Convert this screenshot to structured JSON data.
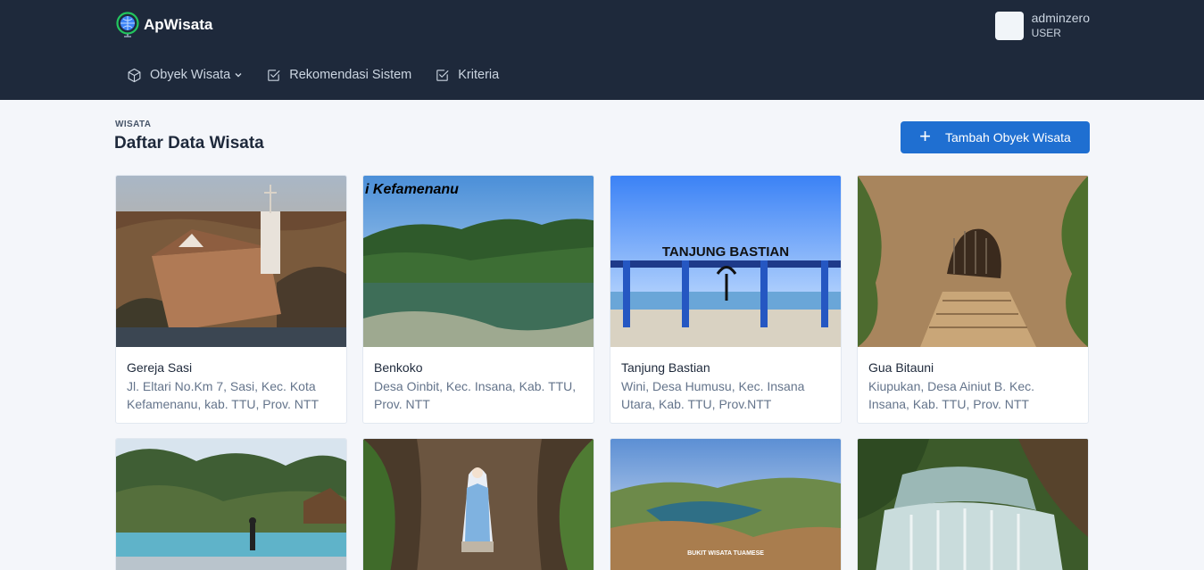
{
  "app": {
    "name": "ApWisata"
  },
  "user": {
    "name": "adminzero",
    "role": "USER"
  },
  "nav": [
    {
      "label": "Obyek Wisata",
      "icon": "cube-icon",
      "has_dropdown": true
    },
    {
      "label": "Rekomendasi Sistem",
      "icon": "checkbox-icon"
    },
    {
      "label": "Kriteria",
      "icon": "checkbox-icon"
    }
  ],
  "page": {
    "kicker": "WISATA",
    "title": "Daftar Data Wisata",
    "add_button": "Tambah Obyek Wisata"
  },
  "cards": [
    {
      "title": "Gereja Sasi",
      "address": "Jl. Eltari No.Km 7, Sasi, Kec. Kota Kefamenanu, kab. TTU, Prov. NTT",
      "image": "church-photo"
    },
    {
      "title": "Benkoko",
      "address": "Desa Oinbit, Kec. Insana, Kab. TTU, Prov. NTT",
      "image": "lake-photo",
      "image_caption": "i Kefamenanu"
    },
    {
      "title": "Tanjung Bastian",
      "address": "Wini, Desa Humusu, Kec. Insana Utara, Kab. TTU, Prov.NTT",
      "image": "beach-gate-photo",
      "image_caption": "TANJUNG BASTIAN"
    },
    {
      "title": "Gua Bitauni",
      "address": "Kiupukan, Desa Ainiut B. Kec. Insana, Kab. TTU, Prov. NTT",
      "image": "cave-photo"
    },
    {
      "title": "",
      "address": "",
      "image": "pool-photo"
    },
    {
      "title": "",
      "address": "",
      "image": "grotto-statue-photo"
    },
    {
      "title": "",
      "address": "",
      "image": "hill-lake-photo",
      "image_caption": "BUKIT WISATA TUAMESE"
    },
    {
      "title": "",
      "address": "",
      "image": "waterfall-photo"
    }
  ]
}
